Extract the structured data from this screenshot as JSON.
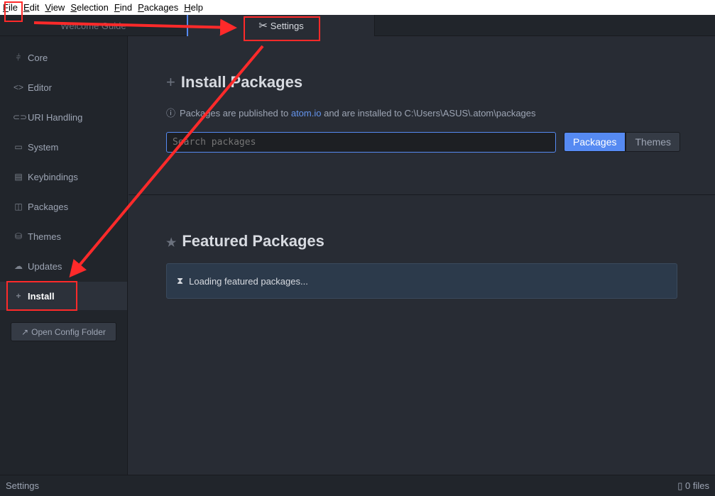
{
  "menu": [
    "File",
    "Edit",
    "View",
    "Selection",
    "Find",
    "Packages",
    "Help"
  ],
  "tabs": {
    "welcome": "Welcome Guide",
    "settings": "Settings"
  },
  "sidebar": {
    "items": [
      {
        "label": "Core",
        "icon": "sliders-icon",
        "glyph": "⫩"
      },
      {
        "label": "Editor",
        "icon": "code-icon",
        "glyph": "<>"
      },
      {
        "label": "URI Handling",
        "icon": "link-icon",
        "glyph": "⊂⊃"
      },
      {
        "label": "System",
        "icon": "monitor-icon",
        "glyph": "▭"
      },
      {
        "label": "Keybindings",
        "icon": "keyboard-icon",
        "glyph": "▤"
      },
      {
        "label": "Packages",
        "icon": "package-icon",
        "glyph": "◫"
      },
      {
        "label": "Themes",
        "icon": "paintcan-icon",
        "glyph": "⛁"
      },
      {
        "label": "Updates",
        "icon": "cloud-download-icon",
        "glyph": "☁"
      },
      {
        "label": "Install",
        "icon": "plus-icon",
        "glyph": "+"
      }
    ],
    "active": "Install",
    "open_config": "Open Config Folder"
  },
  "install": {
    "title": "Install Packages",
    "hint_pre": "Packages are published to ",
    "hint_link": "atom.io",
    "hint_post": " and are installed to C:\\Users\\ASUS\\.atom\\packages",
    "search_placeholder": "Search packages",
    "btn_packages": "Packages",
    "btn_themes": "Themes"
  },
  "featured": {
    "title": "Featured Packages",
    "loading": "Loading featured packages..."
  },
  "status": {
    "left": "Settings",
    "right": "0 files"
  },
  "colors": {
    "accent": "#568af2",
    "annotation": "#ff2a2a"
  }
}
